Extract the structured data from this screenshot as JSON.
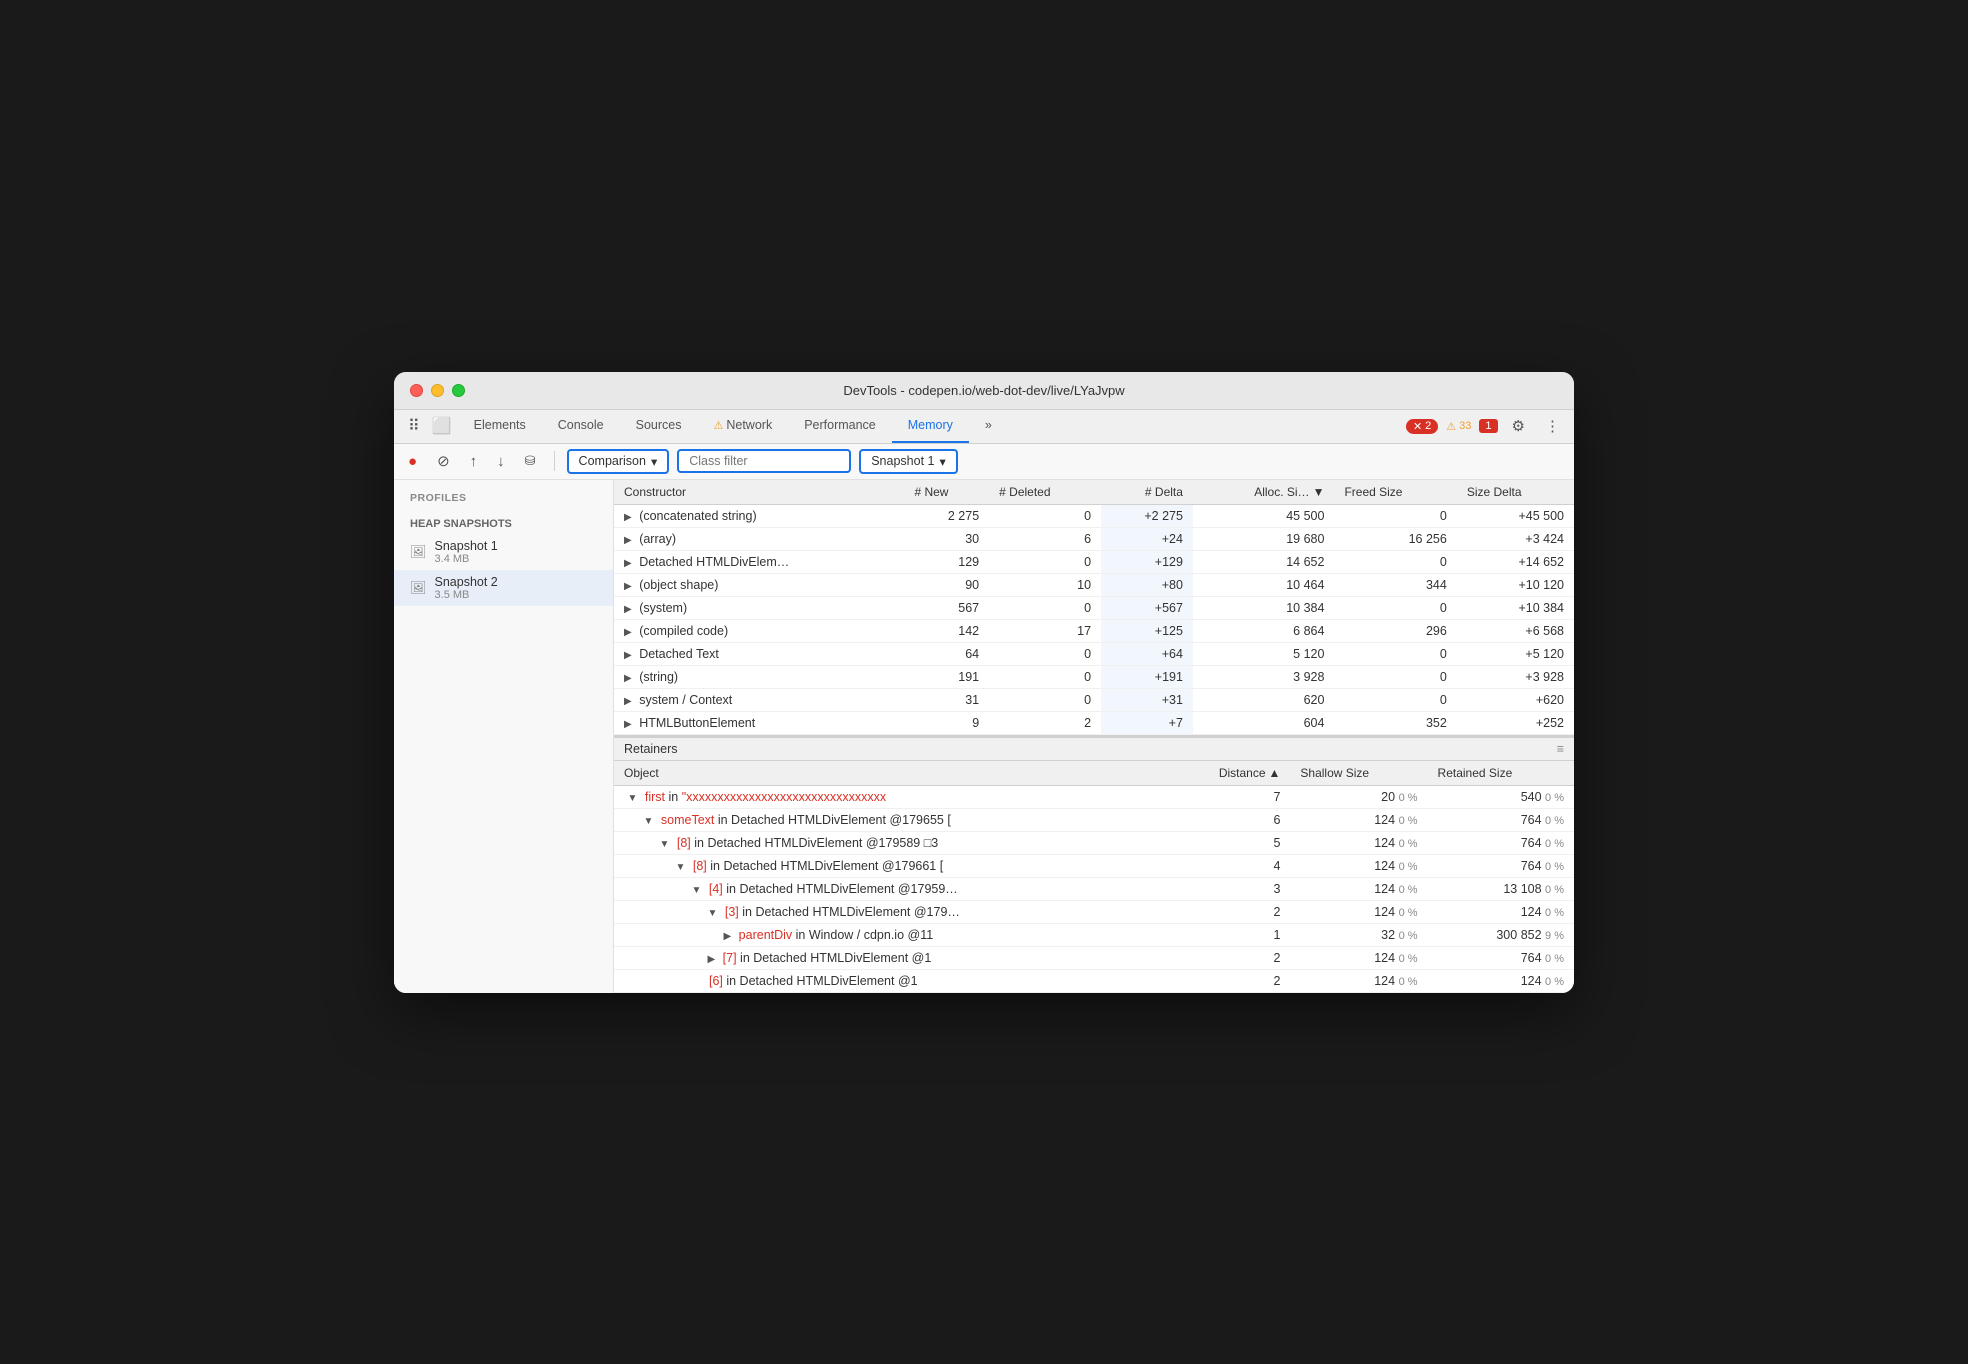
{
  "window": {
    "title": "DevTools - codepen.io/web-dot-dev/live/LYaJvpw"
  },
  "tabs": [
    {
      "label": "Elements",
      "active": false
    },
    {
      "label": "Console",
      "active": false
    },
    {
      "label": "Sources",
      "active": false
    },
    {
      "label": "Network",
      "active": false,
      "has_warning": true
    },
    {
      "label": "Performance",
      "active": false
    },
    {
      "label": "Memory",
      "active": true
    },
    {
      "label": "»",
      "active": false
    }
  ],
  "badges": {
    "errors": "2",
    "warnings": "33",
    "flags": "1"
  },
  "toolbar": {
    "record_label": "●",
    "clear_label": "⊘",
    "upload_label": "↑",
    "download_label": "↓",
    "settings_label": "⚙",
    "more_label": "⋮"
  },
  "secondary_toolbar": {
    "comparison_label": "Comparison",
    "class_filter_placeholder": "Class filter",
    "snapshot_label": "Snapshot 1",
    "dropdown_arrow": "▾"
  },
  "profiles": {
    "section_label": "Profiles",
    "group_label": "HEAP SNAPSHOTS",
    "items": [
      {
        "name": "Snapshot 1",
        "size": "3.4 MB",
        "selected": false
      },
      {
        "name": "Snapshot 2",
        "size": "3.5 MB",
        "selected": true
      }
    ]
  },
  "table": {
    "headers": [
      "Constructor",
      "# New",
      "# Deleted",
      "# Delta",
      "Alloc. Si…",
      "Freed Size",
      "Size Delta"
    ],
    "rows": [
      {
        "constructor": "(concatenated string)",
        "new": "2 275",
        "deleted": "0",
        "delta": "+2 275",
        "alloc": "45 500",
        "freed": "0",
        "size_delta": "+45 500"
      },
      {
        "constructor": "(array)",
        "new": "30",
        "deleted": "6",
        "delta": "+24",
        "alloc": "19 680",
        "freed": "16 256",
        "size_delta": "+3 424"
      },
      {
        "constructor": "Detached HTMLDivElem…",
        "new": "129",
        "deleted": "0",
        "delta": "+129",
        "alloc": "14 652",
        "freed": "0",
        "size_delta": "+14 652"
      },
      {
        "constructor": "(object shape)",
        "new": "90",
        "deleted": "10",
        "delta": "+80",
        "alloc": "10 464",
        "freed": "344",
        "size_delta": "+10 120"
      },
      {
        "constructor": "(system)",
        "new": "567",
        "deleted": "0",
        "delta": "+567",
        "alloc": "10 384",
        "freed": "0",
        "size_delta": "+10 384"
      },
      {
        "constructor": "(compiled code)",
        "new": "142",
        "deleted": "17",
        "delta": "+125",
        "alloc": "6 864",
        "freed": "296",
        "size_delta": "+6 568"
      },
      {
        "constructor": "Detached Text",
        "new": "64",
        "deleted": "0",
        "delta": "+64",
        "alloc": "5 120",
        "freed": "0",
        "size_delta": "+5 120"
      },
      {
        "constructor": "(string)",
        "new": "191",
        "deleted": "0",
        "delta": "+191",
        "alloc": "3 928",
        "freed": "0",
        "size_delta": "+3 928"
      },
      {
        "constructor": "system / Context",
        "new": "31",
        "deleted": "0",
        "delta": "+31",
        "alloc": "620",
        "freed": "0",
        "size_delta": "+620"
      },
      {
        "constructor": "HTMLButtonElement",
        "new": "9",
        "deleted": "2",
        "delta": "+7",
        "alloc": "604",
        "freed": "352",
        "size_delta": "+252"
      }
    ]
  },
  "retainers": {
    "section_label": "Retainers",
    "headers": [
      "Object",
      "Distance",
      "Shallow Size",
      "Retained Size"
    ],
    "rows": [
      {
        "indent": 0,
        "arrow": "▼",
        "prefix_red": "first",
        "middle": " in ",
        "suffix_red": "\"xxxxxxxxxxxxxxxxxxxxxxxxxxxxxxxx",
        "distance": "7",
        "shallow": "20",
        "shallow_pct": "0 %",
        "retained": "540",
        "retained_pct": "0 %"
      },
      {
        "indent": 1,
        "arrow": "▼",
        "prefix_red": "someText",
        "middle": " in Detached HTMLDivElement @179655 [",
        "distance": "6",
        "shallow": "124",
        "shallow_pct": "0 %",
        "retained": "764",
        "retained_pct": "0 %"
      },
      {
        "indent": 2,
        "arrow": "▼",
        "prefix_red": "[8]",
        "middle": " in Detached HTMLDivElement @179589 □3",
        "distance": "5",
        "shallow": "124",
        "shallow_pct": "0 %",
        "retained": "764",
        "retained_pct": "0 %"
      },
      {
        "indent": 3,
        "arrow": "▼",
        "prefix_red": "[8]",
        "middle": " in Detached HTMLDivElement @179661 [",
        "distance": "4",
        "shallow": "124",
        "shallow_pct": "0 %",
        "retained": "764",
        "retained_pct": "0 %"
      },
      {
        "indent": 4,
        "arrow": "▼",
        "prefix_red": "[4]",
        "middle": " in Detached HTMLDivElement @17959…",
        "distance": "3",
        "shallow": "124",
        "shallow_pct": "0 %",
        "retained": "13 108",
        "retained_pct": "0 %"
      },
      {
        "indent": 5,
        "arrow": "▼",
        "prefix_red": "[3]",
        "middle": " in Detached HTMLDivElement @179…",
        "distance": "2",
        "shallow": "124",
        "shallow_pct": "0 %",
        "retained": "124",
        "retained_pct": "0 %"
      },
      {
        "indent": 6,
        "arrow": "▶",
        "prefix_red": "parentDiv",
        "middle": " in Window / cdpn.io @11",
        "distance": "1",
        "shallow": "32",
        "shallow_pct": "0 %",
        "retained": "300 852",
        "retained_pct": "9 %"
      },
      {
        "indent": 5,
        "arrow": "▶",
        "prefix_red": "[7]",
        "middle": " in Detached HTMLDivElement @1",
        "distance": "2",
        "shallow": "124",
        "shallow_pct": "0 %",
        "retained": "764",
        "retained_pct": "0 %"
      },
      {
        "indent": 4,
        "arrow": "",
        "prefix_red": "[6]",
        "middle": " in Detached HTMLDivElement @1",
        "distance": "2",
        "shallow": "124",
        "shallow_pct": "0 %",
        "retained": "124",
        "retained_pct": "0 %"
      }
    ]
  }
}
